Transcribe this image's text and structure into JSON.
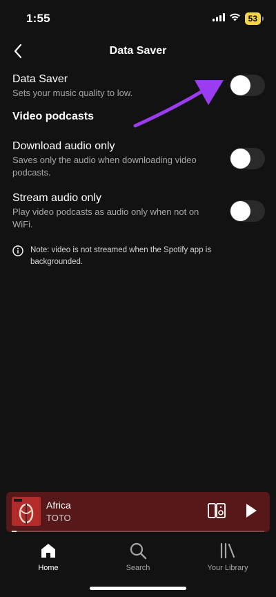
{
  "status_bar": {
    "time": "1:55",
    "battery": "53"
  },
  "header": {
    "title": "Data Saver"
  },
  "settings": {
    "data_saver": {
      "title": "Data Saver",
      "description": "Sets your music quality to low.",
      "enabled": false
    },
    "section_heading": "Video podcasts",
    "download_audio": {
      "title": "Download audio only",
      "description": "Saves only the audio when downloading video podcasts.",
      "enabled": false
    },
    "stream_audio": {
      "title": "Stream audio only",
      "description": "Play video podcasts as audio only when not on WiFi.",
      "enabled": false
    }
  },
  "note": {
    "text": "Note: video is not streamed when the Spotify app is backgrounded."
  },
  "player": {
    "title": "Africa",
    "artist": "TOTO",
    "progress": 0.02
  },
  "tabs": [
    {
      "label": "Home",
      "icon": "home-icon",
      "active": true
    },
    {
      "label": "Search",
      "icon": "search-icon",
      "active": false
    },
    {
      "label": "Your Library",
      "icon": "library-icon",
      "active": false
    }
  ],
  "colors": {
    "background": "#121212",
    "player_background": "#561818",
    "annotation_arrow": "#9b3cf0",
    "toggle_off": "#2a2a2a"
  }
}
